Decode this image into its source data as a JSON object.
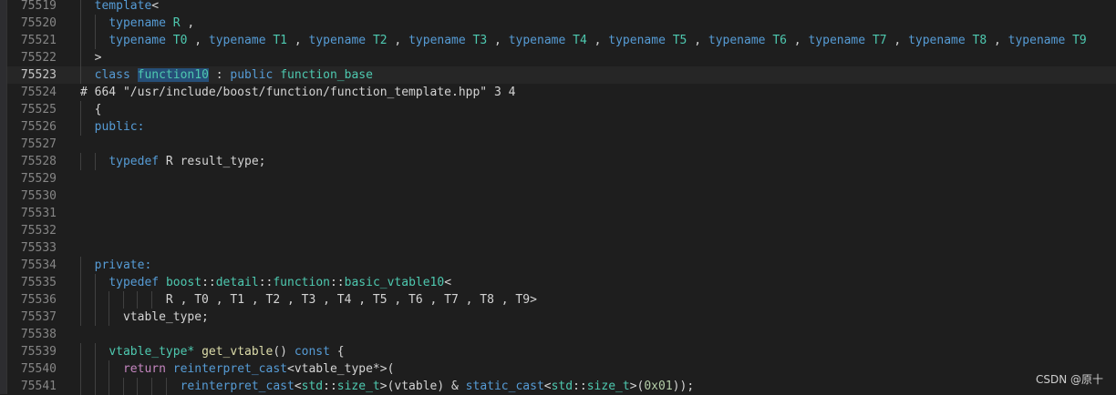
{
  "editor": {
    "current_line": "75523",
    "lines": [
      {
        "n": "75519",
        "indent": 2,
        "tokens": [
          {
            "t": "template",
            "c": "kw"
          },
          {
            "t": "<"
          }
        ]
      },
      {
        "n": "75520",
        "indent": 4,
        "tokens": [
          {
            "t": "typename",
            "c": "kw"
          },
          {
            "t": " "
          },
          {
            "t": "R",
            "c": "tp"
          },
          {
            "t": " ,"
          }
        ]
      },
      {
        "n": "75521",
        "indent": 4,
        "tokens": [
          {
            "t": "typename",
            "c": "kw"
          },
          {
            "t": " "
          },
          {
            "t": "T0",
            "c": "tp"
          },
          {
            "t": " , "
          },
          {
            "t": "typename",
            "c": "kw"
          },
          {
            "t": " "
          },
          {
            "t": "T1",
            "c": "tp"
          },
          {
            "t": " , "
          },
          {
            "t": "typename",
            "c": "kw"
          },
          {
            "t": " "
          },
          {
            "t": "T2",
            "c": "tp"
          },
          {
            "t": " , "
          },
          {
            "t": "typename",
            "c": "kw"
          },
          {
            "t": " "
          },
          {
            "t": "T3",
            "c": "tp"
          },
          {
            "t": " , "
          },
          {
            "t": "typename",
            "c": "kw"
          },
          {
            "t": " "
          },
          {
            "t": "T4",
            "c": "tp"
          },
          {
            "t": " , "
          },
          {
            "t": "typename",
            "c": "kw"
          },
          {
            "t": " "
          },
          {
            "t": "T5",
            "c": "tp"
          },
          {
            "t": " , "
          },
          {
            "t": "typename",
            "c": "kw"
          },
          {
            "t": " "
          },
          {
            "t": "T6",
            "c": "tp"
          },
          {
            "t": " , "
          },
          {
            "t": "typename",
            "c": "kw"
          },
          {
            "t": " "
          },
          {
            "t": "T7",
            "c": "tp"
          },
          {
            "t": " , "
          },
          {
            "t": "typename",
            "c": "kw"
          },
          {
            "t": " "
          },
          {
            "t": "T8",
            "c": "tp"
          },
          {
            "t": " , "
          },
          {
            "t": "typename",
            "c": "kw"
          },
          {
            "t": " "
          },
          {
            "t": "T9",
            "c": "tp"
          }
        ]
      },
      {
        "n": "75522",
        "indent": 2,
        "tokens": [
          {
            "t": ">"
          }
        ]
      },
      {
        "n": "75523",
        "indent": 2,
        "tokens": [
          {
            "t": "class",
            "c": "kw"
          },
          {
            "t": " "
          },
          {
            "t": "function10",
            "c": "tp hl"
          },
          {
            "t": " : "
          },
          {
            "t": "public",
            "c": "kw"
          },
          {
            "t": " "
          },
          {
            "t": "function_base",
            "c": "tp"
          }
        ]
      },
      {
        "n": "75524",
        "indent": 0,
        "tokens": [
          {
            "t": "# 664 \"/usr/include/boost/function/function_template.hpp\" 3 4"
          }
        ]
      },
      {
        "n": "75525",
        "indent": 2,
        "tokens": [
          {
            "t": "{"
          }
        ]
      },
      {
        "n": "75526",
        "indent": 2,
        "tokens": [
          {
            "t": "public:",
            "c": "kw"
          }
        ]
      },
      {
        "n": "75527",
        "indent": 0,
        "tokens": []
      },
      {
        "n": "75528",
        "indent": 4,
        "tokens": [
          {
            "t": "typedef",
            "c": "kw"
          },
          {
            "t": " R result_type;"
          }
        ]
      },
      {
        "n": "75529",
        "indent": 0,
        "tokens": []
      },
      {
        "n": "75530",
        "indent": 0,
        "tokens": []
      },
      {
        "n": "75531",
        "indent": 0,
        "tokens": []
      },
      {
        "n": "75532",
        "indent": 0,
        "tokens": []
      },
      {
        "n": "75533",
        "indent": 0,
        "tokens": []
      },
      {
        "n": "75534",
        "indent": 2,
        "tokens": [
          {
            "t": "private:",
            "c": "kw"
          }
        ]
      },
      {
        "n": "75535",
        "indent": 4,
        "tokens": [
          {
            "t": "typedef",
            "c": "kw"
          },
          {
            "t": " "
          },
          {
            "t": "boost",
            "c": "tp"
          },
          {
            "t": "::"
          },
          {
            "t": "detail",
            "c": "tp"
          },
          {
            "t": "::"
          },
          {
            "t": "function",
            "c": "tp"
          },
          {
            "t": "::"
          },
          {
            "t": "basic_vtable10",
            "c": "tp"
          },
          {
            "t": "<"
          }
        ]
      },
      {
        "n": "75536",
        "indent": 12,
        "tokens": [
          {
            "t": "R , T0 , T1 , T2 , T3 , T4 , T5 , T6 , T7 , T8 , T9>"
          }
        ]
      },
      {
        "n": "75537",
        "indent": 6,
        "tokens": [
          {
            "t": "vtable_type;"
          }
        ]
      },
      {
        "n": "75538",
        "indent": 0,
        "tokens": []
      },
      {
        "n": "75539",
        "indent": 4,
        "tokens": [
          {
            "t": "vtable_type*",
            "c": "tp"
          },
          {
            "t": " "
          },
          {
            "t": "get_vtable",
            "c": "fn"
          },
          {
            "t": "() "
          },
          {
            "t": "const",
            "c": "kw"
          },
          {
            "t": " {"
          }
        ]
      },
      {
        "n": "75540",
        "indent": 6,
        "tokens": [
          {
            "t": "return",
            "c": "ctrl"
          },
          {
            "t": " "
          },
          {
            "t": "reinterpret_cast",
            "c": "kw"
          },
          {
            "t": "<vtable_type*>("
          }
        ]
      },
      {
        "n": "75541",
        "indent": 14,
        "tokens": [
          {
            "t": "reinterpret_cast",
            "c": "kw"
          },
          {
            "t": "<"
          },
          {
            "t": "std",
            "c": "tp"
          },
          {
            "t": "::"
          },
          {
            "t": "size_t",
            "c": "tp"
          },
          {
            "t": ">(vtable) & "
          },
          {
            "t": "static_cast",
            "c": "kw"
          },
          {
            "t": "<"
          },
          {
            "t": "std",
            "c": "tp"
          },
          {
            "t": "::"
          },
          {
            "t": "size_t",
            "c": "tp"
          },
          {
            "t": ">("
          },
          {
            "t": "0x01",
            "c": "num"
          },
          {
            "t": "));"
          }
        ]
      }
    ]
  },
  "watermark": "CSDN @原十"
}
